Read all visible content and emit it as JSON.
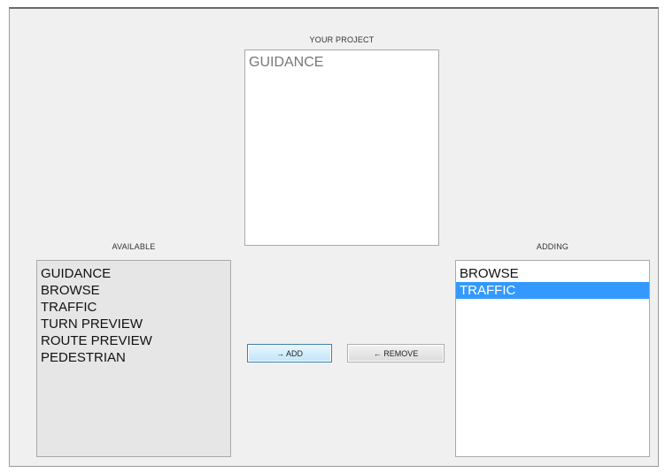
{
  "project": {
    "caption": "YOUR PROJECT",
    "items": [
      "GUIDANCE"
    ]
  },
  "available": {
    "caption": "AVAILABLE",
    "items": [
      "GUIDANCE",
      "BROWSE",
      "TRAFFIC",
      "TURN PREVIEW",
      "ROUTE PREVIEW",
      "PEDESTRIAN"
    ]
  },
  "adding": {
    "caption": "ADDING",
    "items": [
      "BROWSE",
      "TRAFFIC"
    ],
    "selected": "TRAFFIC"
  },
  "buttons": {
    "add_label": "→ ADD",
    "remove_label": "← REMOVE"
  },
  "colors": {
    "selection": "#3399ff",
    "available_bg": "#e6e6e6",
    "window_bg": "#f0f0f0"
  }
}
